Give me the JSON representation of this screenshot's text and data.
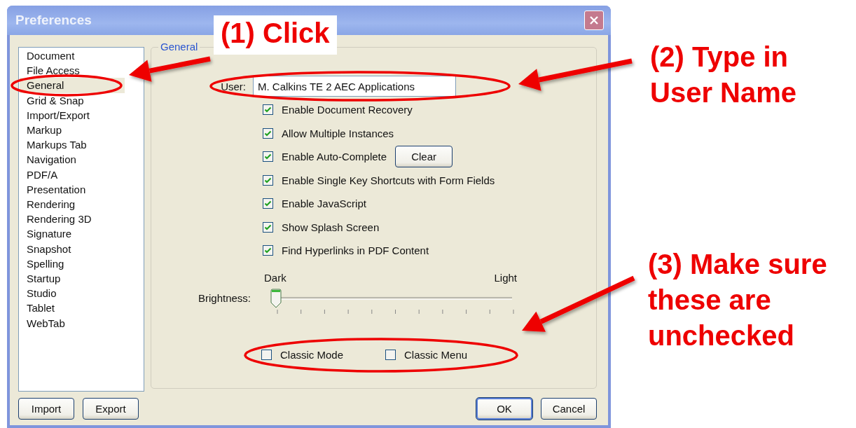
{
  "window": {
    "title": "Preferences"
  },
  "sidebar": {
    "items": [
      {
        "label": "Document",
        "selected": false
      },
      {
        "label": "File Access",
        "selected": false
      },
      {
        "label": "General",
        "selected": true
      },
      {
        "label": "Grid & Snap",
        "selected": false
      },
      {
        "label": "Import/Export",
        "selected": false
      },
      {
        "label": "Markup",
        "selected": false
      },
      {
        "label": "Markups Tab",
        "selected": false
      },
      {
        "label": "Navigation",
        "selected": false
      },
      {
        "label": "PDF/A",
        "selected": false
      },
      {
        "label": "Presentation",
        "selected": false
      },
      {
        "label": "Rendering",
        "selected": false
      },
      {
        "label": "Rendering 3D",
        "selected": false
      },
      {
        "label": "Signature",
        "selected": false
      },
      {
        "label": "Snapshot",
        "selected": false
      },
      {
        "label": "Spelling",
        "selected": false
      },
      {
        "label": "Startup",
        "selected": false
      },
      {
        "label": "Studio",
        "selected": false
      },
      {
        "label": "Tablet",
        "selected": false
      },
      {
        "label": "WebTab",
        "selected": false
      }
    ]
  },
  "sidebar_buttons": [
    "Import",
    "Export"
  ],
  "group": {
    "title": "General"
  },
  "user": {
    "label": "User:",
    "value": "M. Calkins TE 2 AEC Applications"
  },
  "options": [
    {
      "label": "Enable Document Recovery",
      "checked": true
    },
    {
      "label": "Allow Multiple Instances",
      "checked": true
    },
    {
      "label": "Enable Auto-Complete",
      "checked": true,
      "button": "Clear"
    },
    {
      "label": "Enable Single Key Shortcuts with Form Fields",
      "checked": true
    },
    {
      "label": "Enable JavaScript",
      "checked": true
    },
    {
      "label": "Show Splash Screen",
      "checked": true
    },
    {
      "label": "Find Hyperlinks in PDF Content",
      "checked": true
    }
  ],
  "brightness": {
    "label": "Brightness:",
    "min_label": "Dark",
    "max_label": "Light",
    "level": 0
  },
  "classic_options": [
    {
      "label": "Classic Mode",
      "checked": false
    },
    {
      "label": "Classic Menu",
      "checked": false
    }
  ],
  "buttons": [
    {
      "label": "OK",
      "default": true
    },
    {
      "label": "Cancel",
      "default": false
    }
  ],
  "annotations": [
    {
      "kind": "boxed",
      "text": "(1) Click"
    },
    {
      "kind": "plain",
      "text": "(2) Type in User Name"
    },
    {
      "kind": "plain",
      "text": "(3) Make sure these are unchecked"
    }
  ]
}
